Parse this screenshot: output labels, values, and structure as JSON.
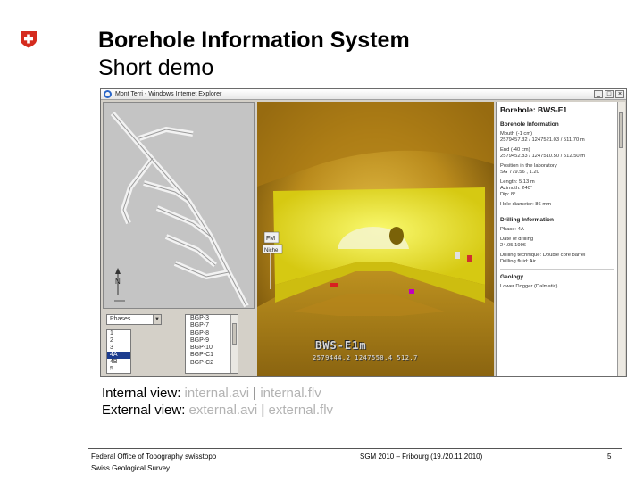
{
  "slide": {
    "title": "Borehole Information System",
    "subtitle": "Short demo",
    "logo_icon": "swiss-cross-icon",
    "colors": {
      "logo_red": "#d52b1e",
      "link_grey": "#b3b3b3"
    }
  },
  "browser": {
    "window_title": "Mont Terri - Windows Internet Explorer",
    "buttons": {
      "minimize": "_",
      "maximize": "□",
      "close": "×"
    },
    "map": {
      "north_label": "N"
    },
    "layer_select": {
      "value": "Phases"
    },
    "phase_list": [
      "1",
      "2",
      "3",
      "4A",
      "4B",
      "5"
    ],
    "phase_selected": "4A",
    "borehole_list": [
      "BGP-3",
      "BGP-7",
      "BGP-8",
      "BGP-9",
      "BGP-10",
      "BGP-C1",
      "BGP-C2"
    ],
    "view3d": {
      "borehole_label": "BWS-E1m",
      "coords": "2579444.2 1247550.4 512.7",
      "sign_fm": "FM",
      "sign_niche": "Niche"
    },
    "info": {
      "heading": "Borehole: BWS-E1",
      "section1": "Borehole Information",
      "mouth": "Mouth (-1 cm)\n2579457.32 / 1247521.03 / 511.70 m",
      "end": "End (-40 cm)\n2579452.83 / 1247510.50 / 512.50 m",
      "position": "Position in the laboratory\nSG 779.56 , 1.20",
      "length": "Length: 5.13 m\nAzimuth: 240°\nDip: 8°",
      "diameter": "Hole diameter: 86 mm",
      "section2": "Drilling Information",
      "phase": "Phase: 4A",
      "date": "Date of drilling\n24.05.1996",
      "technique": "Drilling technique: Double core barrel\nDrilling fluid: Air",
      "section3": "Geology",
      "geology": "Lower Dogger (Dalmatic)"
    }
  },
  "links": {
    "internal_label": "Internal view:",
    "internal_avi": "internal.avi",
    "internal_flv": "internal.flv",
    "external_label": "External view:",
    "external_avi": "external.avi",
    "external_flv": "external.flv",
    "separator": "|"
  },
  "footer": {
    "org": "Federal Office of Topography swisstopo",
    "survey": "Swiss Geological Survey",
    "event": "SGM 2010 – Fribourg (19./20.11.2010)",
    "page_number": "5"
  }
}
